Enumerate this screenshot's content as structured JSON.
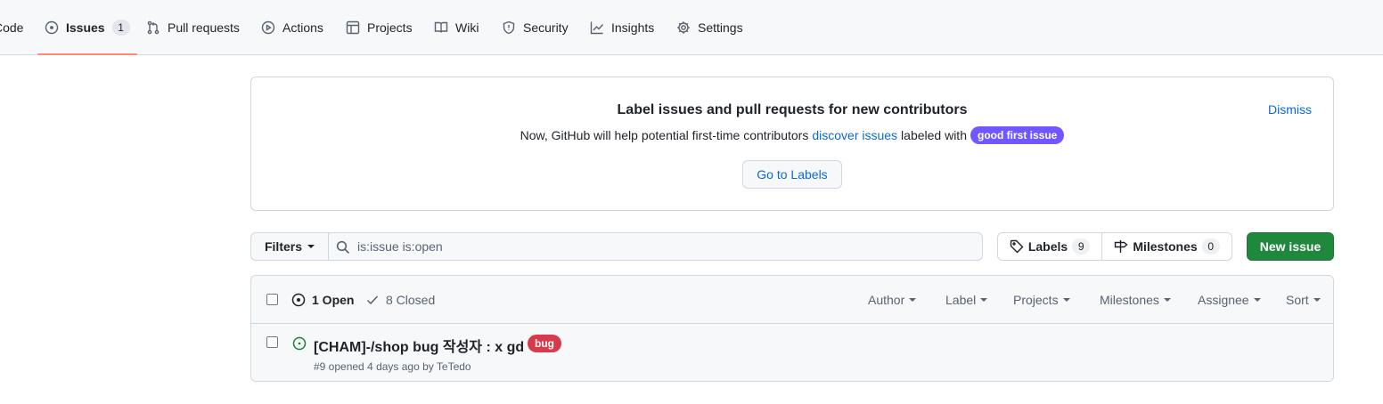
{
  "nav": {
    "items": [
      {
        "label": "Code",
        "icon": "code-icon"
      },
      {
        "label": "Issues",
        "icon": "issue-opened-icon",
        "count": "1",
        "selected": true
      },
      {
        "label": "Pull requests",
        "icon": "git-pull-request-icon"
      },
      {
        "label": "Actions",
        "icon": "play-icon"
      },
      {
        "label": "Projects",
        "icon": "table-icon"
      },
      {
        "label": "Wiki",
        "icon": "book-icon"
      },
      {
        "label": "Security",
        "icon": "shield-icon"
      },
      {
        "label": "Insights",
        "icon": "graph-icon"
      },
      {
        "label": "Settings",
        "icon": "gear-icon"
      }
    ]
  },
  "banner": {
    "title": "Label issues and pull requests for new contributors",
    "desc_before": "Now, GitHub will help potential first-time contributors",
    "desc_link": "discover issues",
    "desc_after": "labeled with",
    "label": "good first issue",
    "label_color": "#7057ff",
    "dismiss": "Dismiss",
    "button": "Go to Labels"
  },
  "filters": {
    "button": "Filters",
    "query": "is:issue is:open",
    "labels_label": "Labels",
    "labels_count": "9",
    "milestones_label": "Milestones",
    "milestones_count": "0",
    "new_issue": "New issue"
  },
  "list": {
    "open_label": "1 Open",
    "closed_label": "8 Closed",
    "header_filters": [
      "Author",
      "Label",
      "Projects",
      "Milestones",
      "Assignee",
      "Sort"
    ],
    "issues": [
      {
        "title": "[CHAM]-/shop bug 작성자 : x gd",
        "label": "bug",
        "label_color": "#d73a4a",
        "meta_prefix": "#9 opened 4 days ago by",
        "author": "TeTedo"
      }
    ]
  },
  "colors": {
    "accent_underline": "#fd8c73",
    "primary_button": "#1f883d",
    "link": "#0969da",
    "open_icon": "#1a7f37"
  }
}
